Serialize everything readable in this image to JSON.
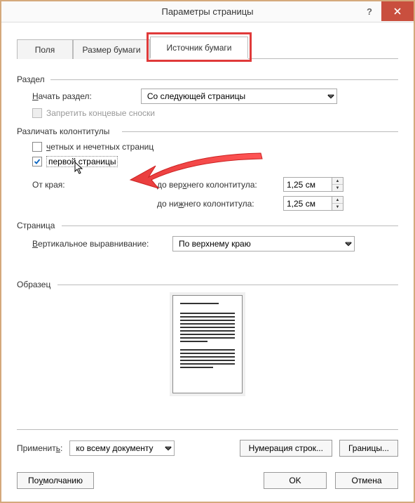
{
  "title": "Параметры страницы",
  "tabs": {
    "t1": "Поля",
    "t2": "Размер бумаги",
    "t3": "Источник бумаги"
  },
  "section": {
    "label": "Раздел",
    "start_label": "Начать раздел:",
    "start_value": "Со следующей страницы",
    "suppress_endnotes": "Запретить концевые сноски"
  },
  "headers": {
    "label": "Различать колонтитулы",
    "odd_even": "четных и нечетных страниц",
    "first_page": "первой страницы",
    "from_edge": "От края:",
    "header_label": "до верхнего колонтитула:",
    "header_value": "1,25 см",
    "footer_label": "до нижнего колонтитула:",
    "footer_value": "1,25 см"
  },
  "page": {
    "label": "Страница",
    "valign_label": "Вертикальное выравнивание:",
    "valign_value": "По верхнему краю"
  },
  "preview": {
    "label": "Образец"
  },
  "apply": {
    "label": "Применить:",
    "value": "ко всему документу"
  },
  "buttons": {
    "line_numbers": "Нумерация строк...",
    "borders": "Границы...",
    "default": "По умолчанию",
    "ok": "OK",
    "cancel": "Отмена"
  }
}
